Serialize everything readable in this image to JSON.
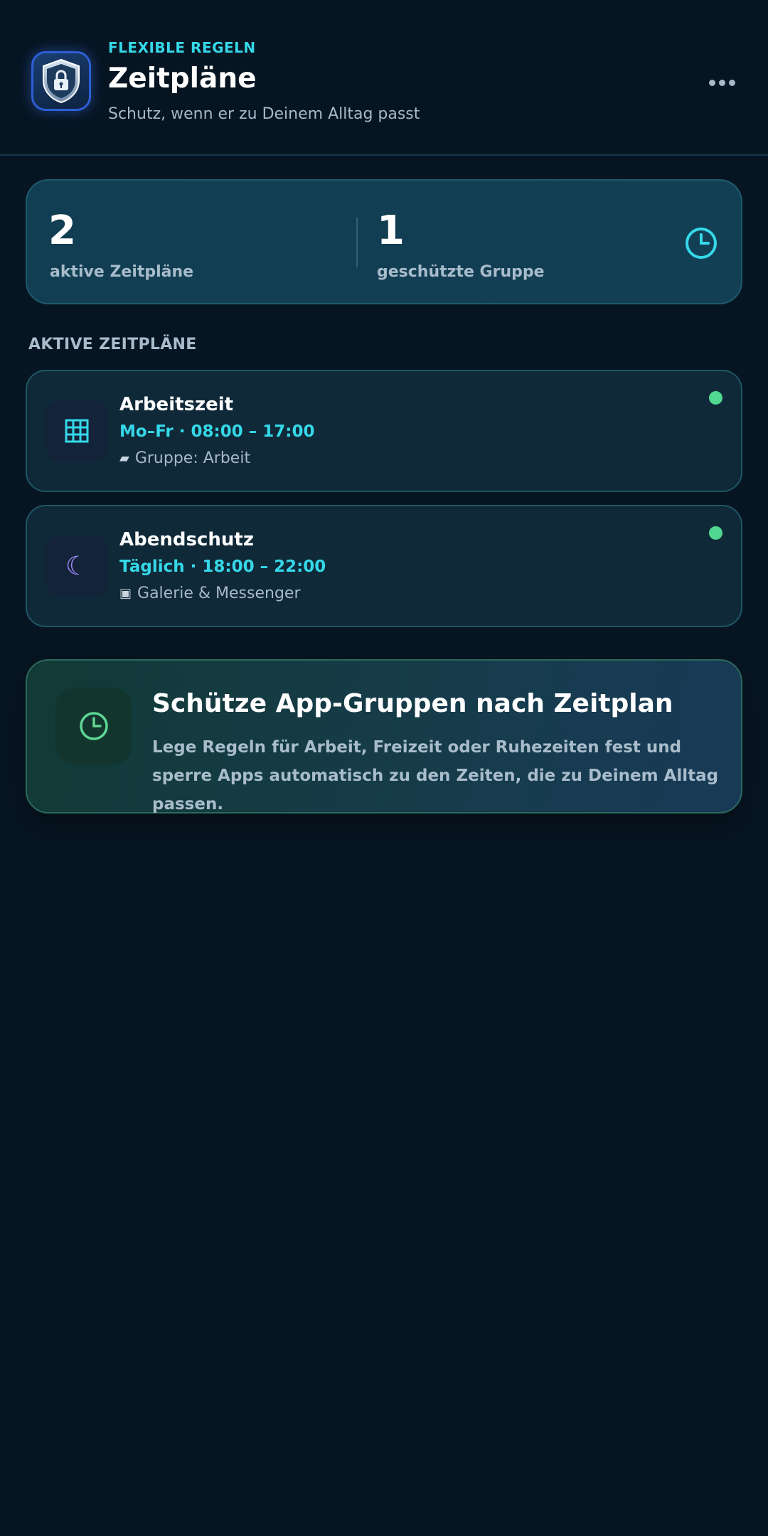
{
  "header": {
    "eyebrow": "FLEXIBLE REGELN",
    "title": "Zeitpläne",
    "subtitle": "Schutz, wenn er zu Deinem Alltag passt",
    "logo_icon": "shield-lock-icon",
    "menu_icon": "more-horizontal-icon"
  },
  "stats": {
    "active_count": "2",
    "active_label": "aktive Zeitpläne",
    "protected_count": "1",
    "protected_label": "geschützte Gruppe",
    "icon": "clock-icon"
  },
  "section": {
    "title": "AKTIVE ZEITPLÄNE"
  },
  "schedules": [
    {
      "name": "Arbeitszeit",
      "time": "Mo–Fr · 08:00 – 17:00",
      "icon": "building-icon",
      "group_icon": "folder-icon",
      "group_glyph": "▰",
      "group": "Gruppe: Arbeit",
      "active": true
    },
    {
      "name": "Abendschutz",
      "time": "Täglich · 18:00 – 22:00",
      "icon": "moon-icon",
      "icon_glyph": "☾",
      "group_icon": "app-square-icon",
      "group_glyph": "▣",
      "group": "Galerie & Messenger",
      "active": true
    }
  ],
  "promo": {
    "title": "Schütze App-Gruppen nach Zeitplan",
    "text": "Lege Regeln für Arbeit, Freizeit oder Ruhezeiten fest und sperre Apps automatisch zu den Zeiten, die zu Deinem Alltag passen.",
    "icon": "clock-icon"
  },
  "colors": {
    "background": "#071522",
    "accent": "#35d8e8",
    "active_green": "#50d890",
    "moon_purple": "#a58cff",
    "promo_green": "#5fd694"
  }
}
